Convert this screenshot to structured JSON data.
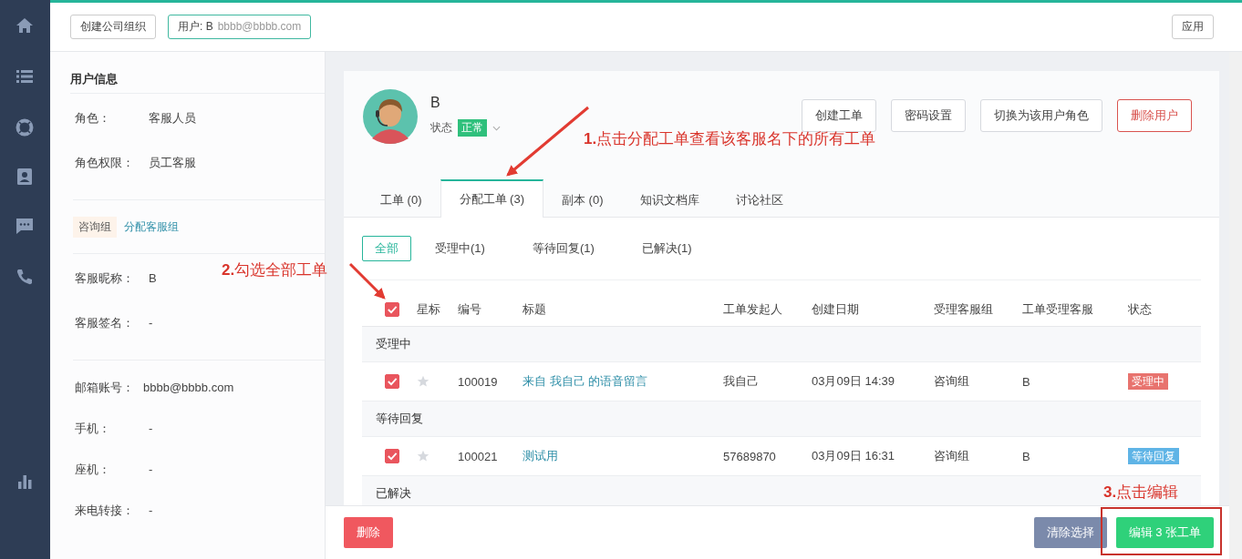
{
  "top_bar": {
    "tabs": [
      {
        "label": "创建公司组织",
        "selected": false
      },
      {
        "label": "用户: B",
        "sub": "bbbb@bbbb.com",
        "selected": true
      }
    ],
    "apply_button": "应用"
  },
  "user_info": {
    "title": "用户信息",
    "roles": [
      {
        "label": "角色：",
        "value": "客服人员"
      },
      {
        "label": "角色权限：",
        "value": "员工客服"
      }
    ],
    "group_tag": "咨询组",
    "assign_link": "分配客服组",
    "agent": [
      {
        "label": "客服昵称：",
        "value": "B"
      },
      {
        "label": "客服签名：",
        "value": "-"
      }
    ],
    "contact": [
      {
        "label": "邮箱账号：",
        "value": "bbbb@bbbb.com"
      },
      {
        "label": "手机：",
        "value": "-"
      },
      {
        "label": "座机：",
        "value": "-"
      },
      {
        "label": "来电转接：",
        "value": "-"
      }
    ]
  },
  "profile": {
    "name": "B",
    "status_label": "状态",
    "status": "正常",
    "actions": [
      {
        "label": "创建工单",
        "kind": "default"
      },
      {
        "label": "密码设置",
        "kind": "default"
      },
      {
        "label": "切换为该用户角色",
        "kind": "default"
      },
      {
        "label": "删除用户",
        "kind": "danger"
      }
    ]
  },
  "tabs": [
    {
      "label": "工单 (0)",
      "selected": false
    },
    {
      "label": "分配工单 (3)",
      "selected": true
    },
    {
      "label": "副本 (0)",
      "selected": false
    },
    {
      "label": "知识文档库",
      "selected": false
    },
    {
      "label": "讨论社区",
      "selected": false
    }
  ],
  "filters": [
    {
      "label": "全部",
      "selected": true
    },
    {
      "label": "受理中(1)",
      "selected": false
    },
    {
      "label": "等待回复(1)",
      "selected": false
    },
    {
      "label": "已解决(1)",
      "selected": false
    }
  ],
  "table": {
    "select_all": true,
    "columns": [
      "星标",
      "编号",
      "标题",
      "工单发起人",
      "创建日期",
      "受理客服组",
      "工单受理客服",
      "状态"
    ],
    "groups": [
      {
        "name": "受理中",
        "rows": [
          {
            "checked": true,
            "starred": false,
            "id": "100019",
            "title": "来自 我自己 的语音留言",
            "requester": "我自己",
            "created": "03月09日 14:39",
            "group": "咨询组",
            "agent": "B",
            "status": "受理中",
            "color": "#e8736e"
          }
        ]
      },
      {
        "name": "等待回复",
        "rows": [
          {
            "checked": true,
            "starred": false,
            "id": "100021",
            "title": "测试用",
            "requester": "57689870",
            "created": "03月09日 16:31",
            "group": "咨询组",
            "agent": "B",
            "status": "等待回复",
            "color": "#5fb4e6"
          }
        ]
      },
      {
        "name": "已解决"
      }
    ]
  },
  "bottom_bar": {
    "delete": "删除",
    "clear": "清除选择",
    "edit": "编辑 3 张工单"
  },
  "annotations": [
    {
      "kind": "arrow-callout",
      "text": "**1.**点击分配工单查看该客服名下的所有工单"
    },
    {
      "kind": "arrow-callout",
      "text": "**2.**勾选全部工单"
    },
    {
      "kind": "box-callout",
      "text": "**3.**点击编辑"
    }
  ]
}
